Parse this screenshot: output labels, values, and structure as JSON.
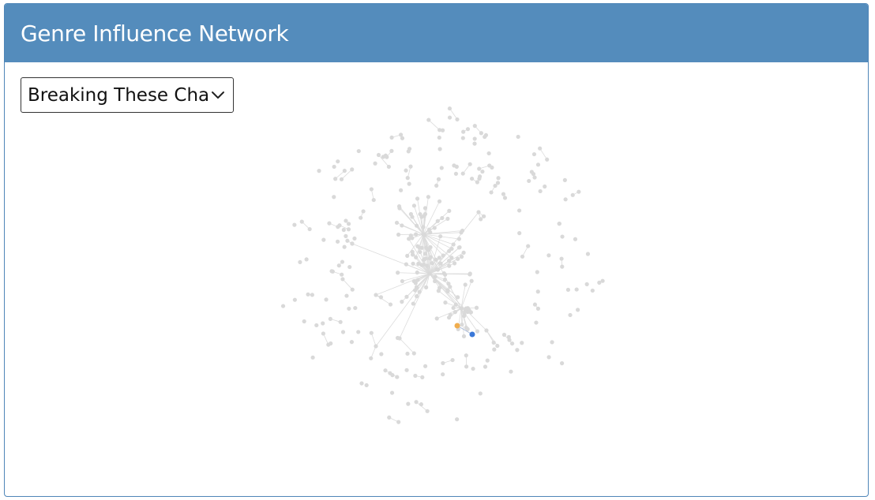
{
  "header": {
    "title": "Genre Influence Network"
  },
  "controls": {
    "song_select": {
      "selected": "Breaking These Chains",
      "icon": "chevron-down-icon"
    }
  },
  "network": {
    "colors": {
      "node": "#d9d9d9",
      "edge": "#dcdcdc",
      "highlight_node": "#f0ad4e",
      "selected_node": "#3b78d8"
    }
  }
}
